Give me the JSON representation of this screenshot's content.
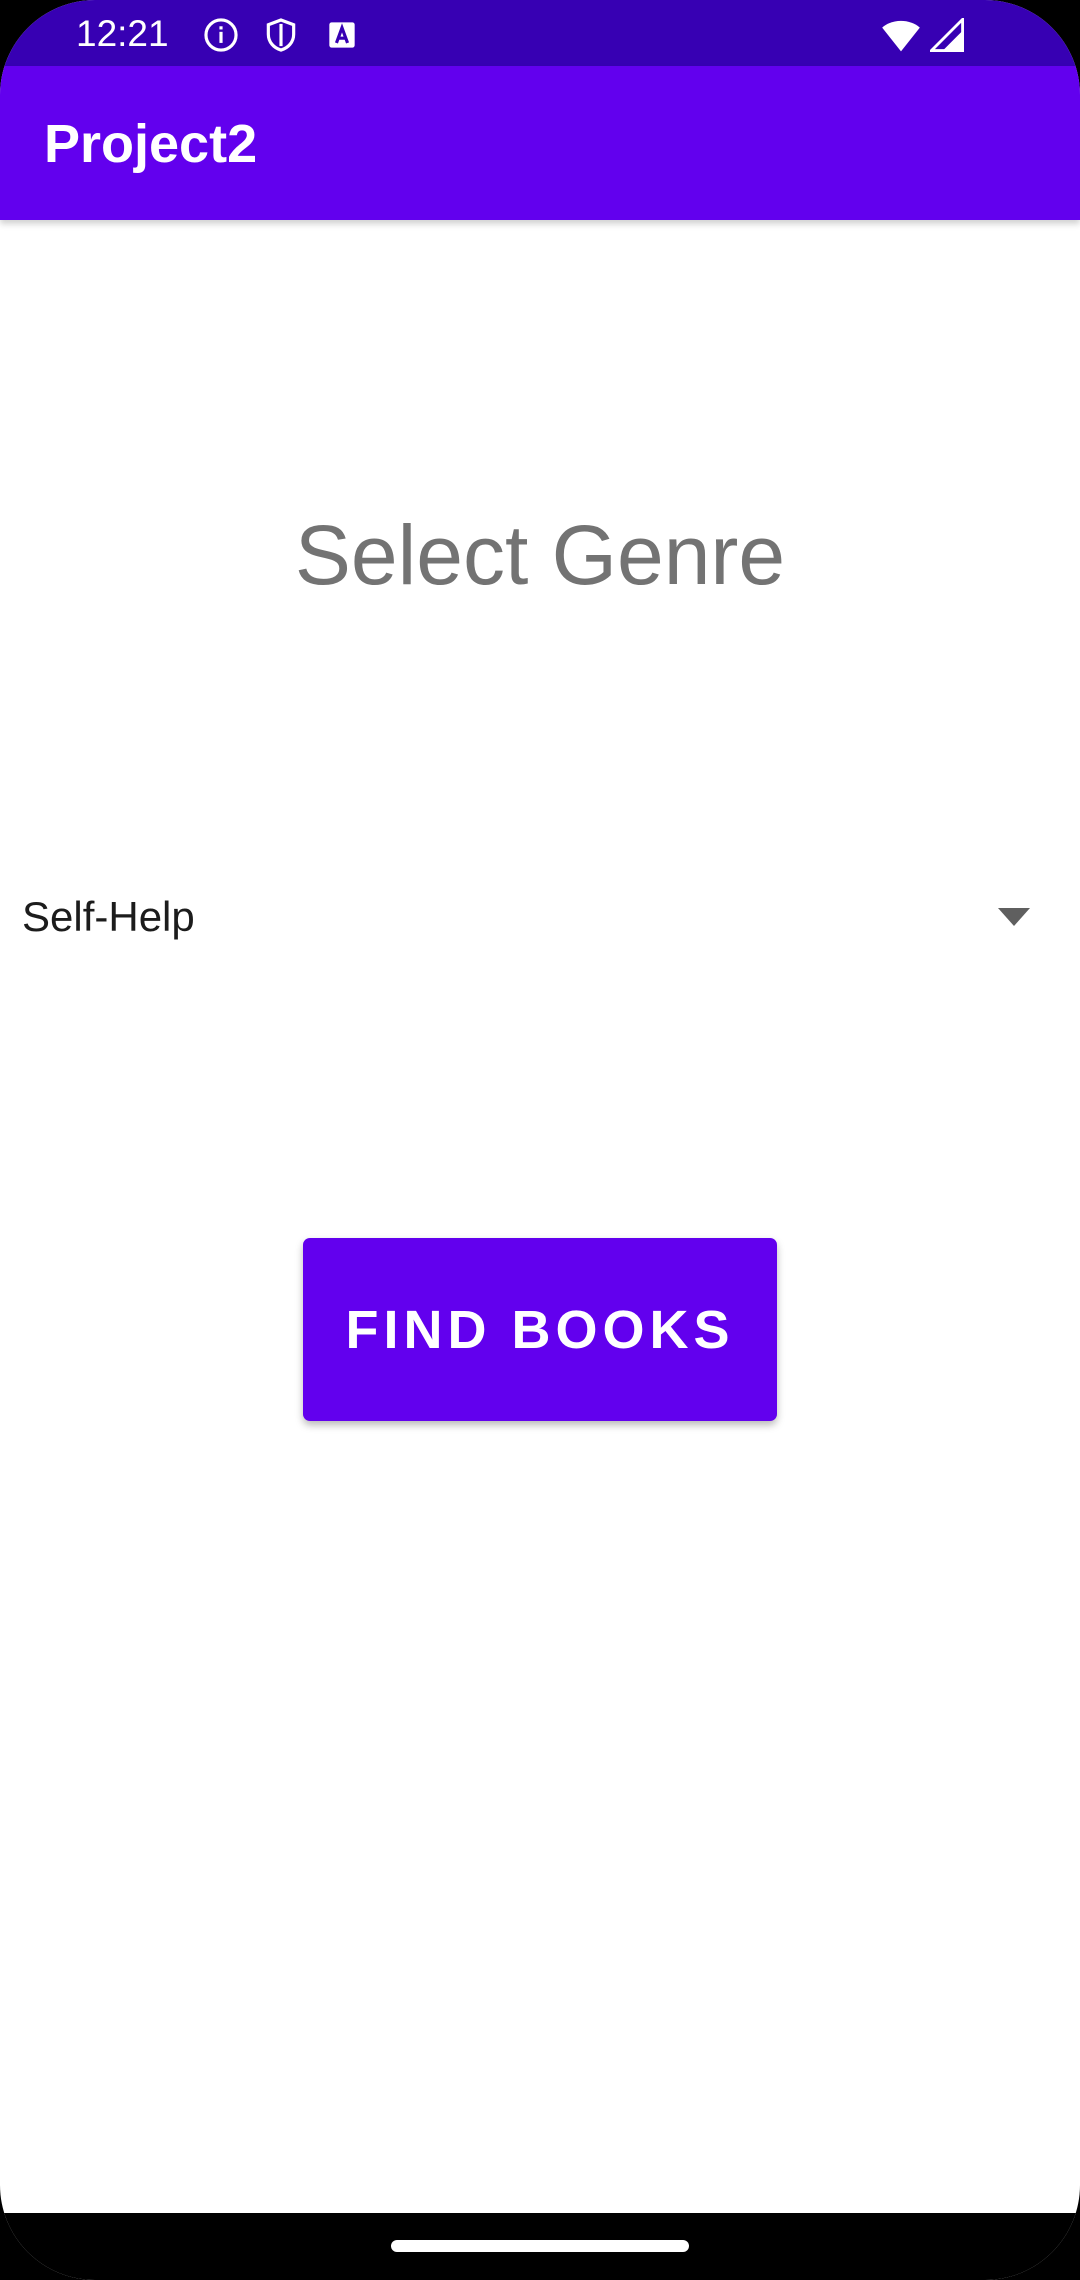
{
  "status_bar": {
    "time": "12:21",
    "left_icons": [
      "info-icon",
      "shield-icon",
      "font-a-icon"
    ],
    "right_icons": [
      "wifi-icon",
      "cellular-signal-icon"
    ]
  },
  "app_bar": {
    "title": "Project2",
    "color": "#6200ee"
  },
  "main": {
    "heading": "Select Genre",
    "genre_spinner": {
      "selected": "Self-Help"
    },
    "find_button_label": "FIND BOOKS"
  },
  "colors": {
    "status_bar": "#3700b3",
    "primary": "#6200ee",
    "heading_text": "#737373",
    "background": "#ffffff"
  }
}
